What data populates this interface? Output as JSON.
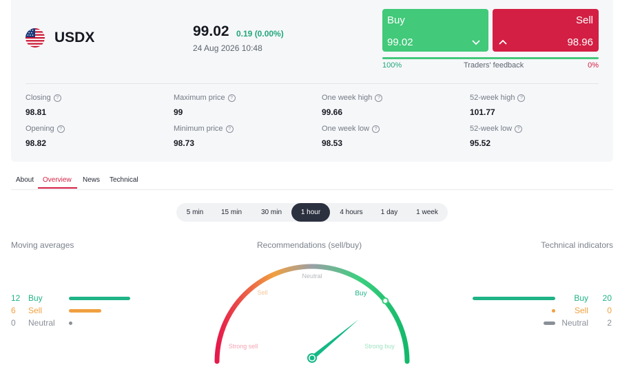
{
  "instrument": {
    "symbol": "USDX",
    "icon": "us-flag-icon"
  },
  "quote": {
    "price": "99.02",
    "change": "0.19 (0.00%)",
    "datetime": "24 Aug 2026 10:48"
  },
  "trade": {
    "buy_label": "Buy",
    "buy_price": "99.02",
    "sell_label": "Sell",
    "sell_price": "98.96",
    "feedback_left": "100%",
    "feedback_label": "Traders' feedback",
    "feedback_right": "0%",
    "buy_share": 1.0
  },
  "stats": [
    {
      "label": "Closing",
      "value": "98.81"
    },
    {
      "label": "Maximum price",
      "value": "99"
    },
    {
      "label": "One week high",
      "value": "99.66"
    },
    {
      "label": "52-week high",
      "value": "101.77"
    },
    {
      "label": "Opening",
      "value": "98.82"
    },
    {
      "label": "Minimum price",
      "value": "98.73"
    },
    {
      "label": "One week low",
      "value": "98.53"
    },
    {
      "label": "52-week low",
      "value": "95.52"
    }
  ],
  "tabs": [
    "About",
    "Overview",
    "News",
    "Technical"
  ],
  "active_tab": "Overview",
  "periods": [
    "5 min",
    "15 min",
    "30 min",
    "1 hour",
    "4 hours",
    "1 day",
    "1 week"
  ],
  "active_period": "1 hour",
  "moving_averages": {
    "title": "Moving averages",
    "buy": {
      "count": "12",
      "label": "Buy"
    },
    "sell": {
      "count": "6",
      "label": "Sell"
    },
    "neutral": {
      "count": "0",
      "label": "Neutral"
    }
  },
  "recommendations": {
    "title": "Recommendations (sell/buy)",
    "labels": {
      "strong_sell": "Strong sell",
      "sell": "Sell",
      "neutral": "Neutral",
      "buy": "Buy",
      "strong_buy": "Strong buy"
    },
    "needle_level": 0.78
  },
  "technical_indicators": {
    "title": "Technical indicators",
    "buy": {
      "count": "20",
      "label": "Buy"
    },
    "sell": {
      "count": "0",
      "label": "Sell"
    },
    "neutral": {
      "count": "2",
      "label": "Neutral"
    }
  },
  "colors": {
    "buy": "#42c97a",
    "sell": "#d31f43",
    "positive": "#22a77a",
    "ma_buy": "#1fb386",
    "ma_sell": "#f0a040",
    "neutral": "#8a8f98"
  }
}
